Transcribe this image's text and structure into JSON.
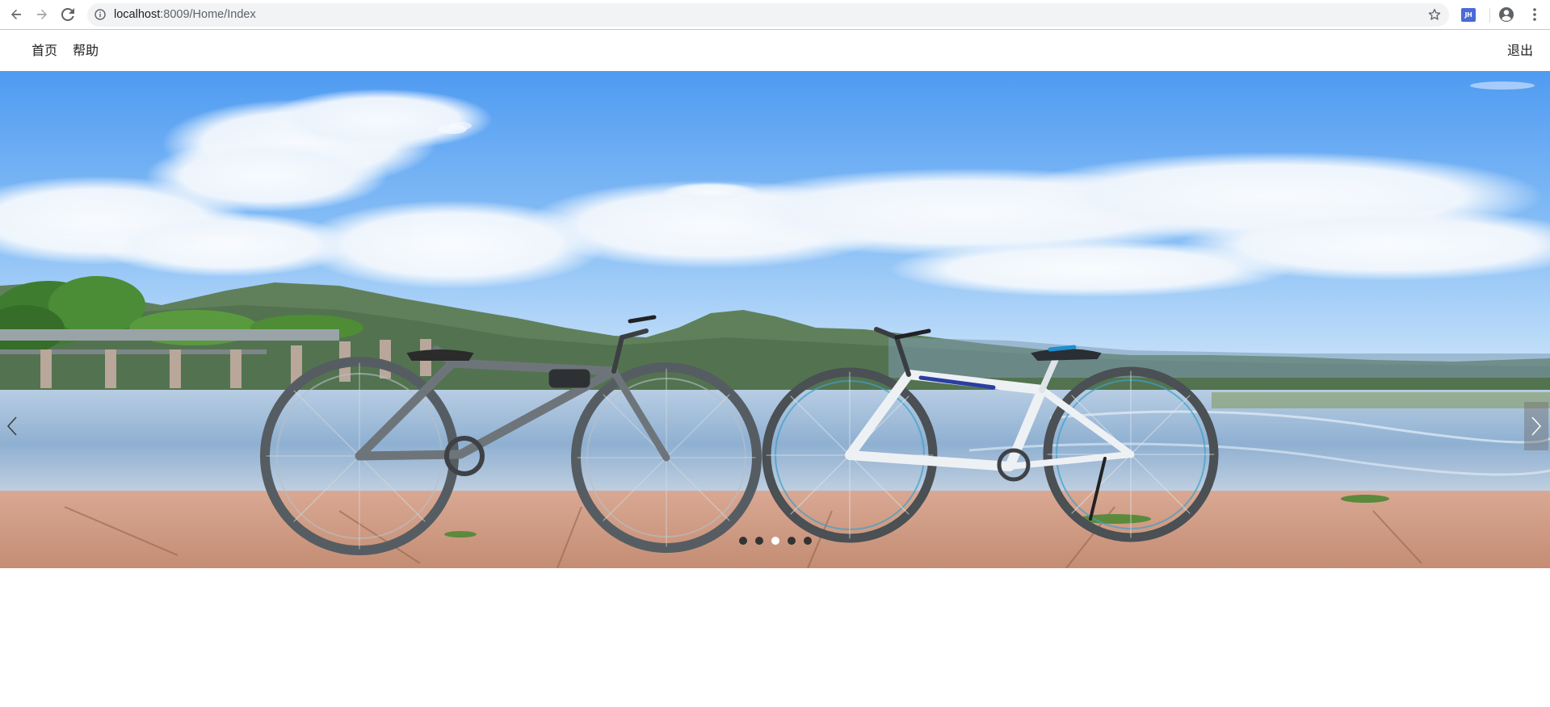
{
  "browser": {
    "url_host": "localhost",
    "url_path": ":8009/Home/Index",
    "extension_label": "JH",
    "icons": {
      "back": "arrow-left-icon",
      "forward": "arrow-right-icon",
      "reload": "reload-icon",
      "info": "info-icon",
      "bookmark": "star-icon",
      "profile": "account-circle-icon",
      "menu": "kebab-menu-icon"
    }
  },
  "nav": {
    "home": "首页",
    "help": "帮助",
    "logout": "退出"
  },
  "carousel": {
    "slide_count": 5,
    "active_index": 2,
    "scene": "two bicycles parked on a stone embankment by a lake with mountains and clouds",
    "prev_icon": "chevron-left-icon",
    "next_icon": "chevron-right-icon"
  },
  "colors": {
    "sky_top": "#4f9bf2",
    "sky_bottom": "#bfdcf8",
    "mountain": "#5d7a5b",
    "water": "#8fb0d2",
    "ground": "#cf9a82",
    "nav_text": "#222222",
    "dot": "#333333",
    "dot_active": "#ffffff"
  }
}
